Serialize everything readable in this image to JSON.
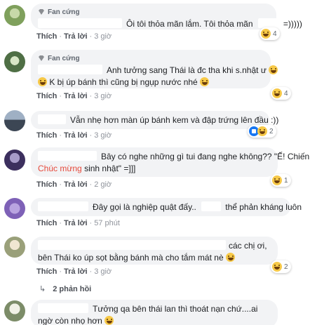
{
  "actions": {
    "like": "Thích",
    "reply": "Trả lời",
    "sep": "·"
  },
  "comments": [
    {
      "badge": "Fan cứng",
      "text": "Ôi tôi thỏa mãn lắm. Tôi thỏa mãn",
      "text_end": "=)))))",
      "time": "3 giờ",
      "reaction_count": "4"
    },
    {
      "badge": "Fan cứng",
      "text": "Anh tưởng sang Thái là đc tha khi s.nhật ư",
      "text2": "K bị úp bánh thì cũng bị ngụp nước nhé",
      "time": "3 giờ",
      "reaction_count": "4"
    },
    {
      "text": "Vẫn nhẹ hơn màn úp bánh kem và đập trứng lên đầu :))",
      "time": "3 giờ",
      "reaction_count": "2"
    },
    {
      "text": "Bây có nghe những gì tui đang nghe không?? \"Ế! Chiến!",
      "text_highlight": "Chúc mừng",
      "text_end": "sinh nhật\" =]]]",
      "time": "2 giờ",
      "reaction_count": "1"
    },
    {
      "text": "Đây gọi là nghiệp quật đấy..",
      "text_end": "thể phản kháng luôn",
      "time": "57 phút"
    },
    {
      "text": "các chị ơi, bên Thái ko úp sọt bằng bánh mà cho tắm mát nè",
      "time": "3 giờ",
      "reaction_count": "2",
      "replies": "2 phản hồi"
    },
    {
      "text": "Tưởng qa bên thái lan thì thoát nạn chứ....ai ngờ còn nhọ hơn"
    }
  ]
}
